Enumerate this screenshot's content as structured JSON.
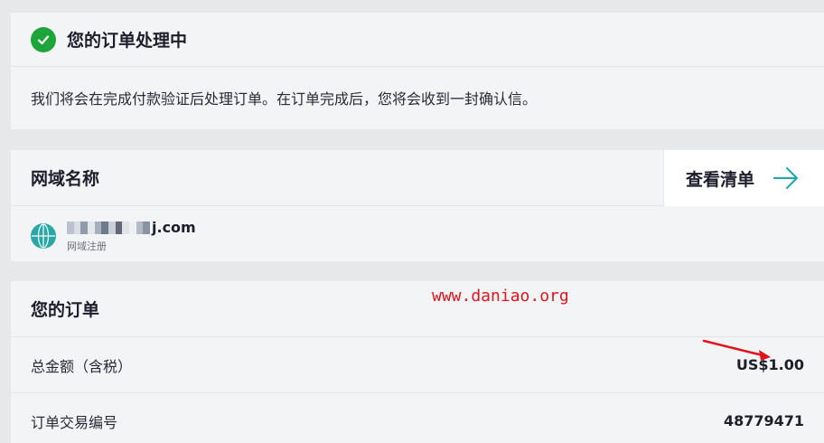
{
  "status_card": {
    "title": "您的订单处理中",
    "message": "我们将会在完成付款验证后处理订单。在订单完成后，您将会收到一封确认信。",
    "icon": "check-circle-icon",
    "icon_color": "#1ea53a"
  },
  "domain_card": {
    "title": "网域名称",
    "view_list_label": "查看清单",
    "domain_suffix": "j.com",
    "domain_type": "网域注册",
    "accent": "#2aa6a6"
  },
  "order_card": {
    "title": "您的订单",
    "watermark": "www.daniao.org",
    "rows": [
      {
        "label": "总金额（含税）",
        "value": "US$1.00"
      },
      {
        "label": "订单交易编号",
        "value": "48779471"
      }
    ]
  }
}
